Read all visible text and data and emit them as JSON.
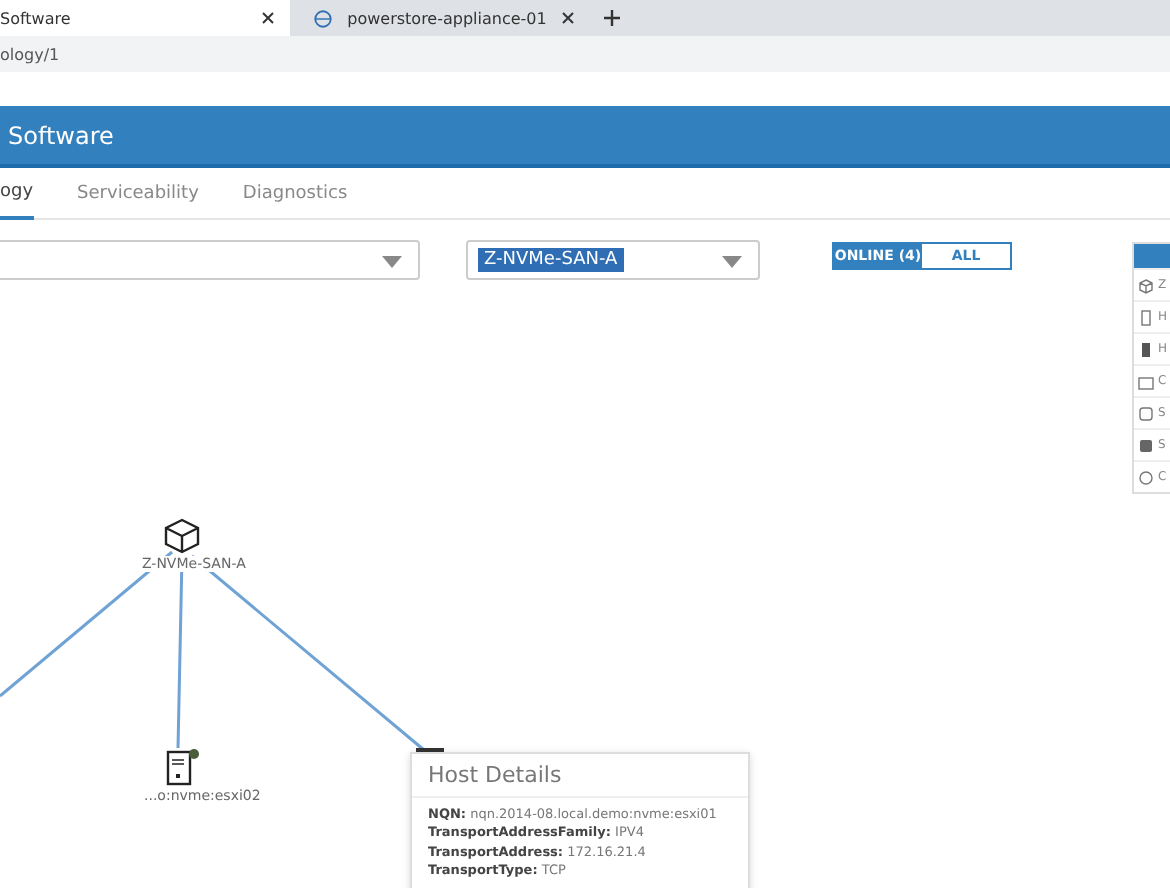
{
  "browser_tabs": [
    {
      "title": "Software",
      "selected": true
    },
    {
      "title": "powerstore-appliance-01",
      "selected": false
    }
  ],
  "address": "ology/1",
  "header": {
    "title": "Software"
  },
  "nav_tabs": [
    {
      "label": "ogy",
      "selected": true
    },
    {
      "label": "Serviceability",
      "selected": false
    },
    {
      "label": "Diagnostics",
      "selected": false
    }
  ],
  "filters": {
    "network_value": "Z-NVMe-SAN-A"
  },
  "status_toggle": [
    {
      "label": "ONLINE (4)",
      "selected": true
    },
    {
      "label": "ALL",
      "selected": false
    }
  ],
  "legend": [
    {
      "kind": "cube",
      "label": "Z"
    },
    {
      "kind": "host",
      "label": "H"
    },
    {
      "kind": "host-dark",
      "label": "H"
    },
    {
      "kind": "storage",
      "label": "C"
    },
    {
      "kind": "drive",
      "label": "S"
    },
    {
      "kind": "drive-dark",
      "label": "S"
    },
    {
      "kind": "cluster",
      "label": "C"
    }
  ],
  "topology": {
    "network": {
      "label": "Z-NVMe-SAN-A"
    },
    "hosts": [
      {
        "label": "...o:nvme:esxi02",
        "online": true
      }
    ]
  },
  "tooltip": {
    "title": "Host Details",
    "fields": [
      {
        "key": "NQN:",
        "value": "nqn.2014-08.local.demo:nvme:esxi01"
      },
      {
        "key": "TransportAddressFamily:",
        "value": "IPV4"
      },
      {
        "key": "TransportAddress:",
        "value": "172.16.21.4"
      },
      {
        "key": "TransportType:",
        "value": "TCP"
      }
    ]
  }
}
